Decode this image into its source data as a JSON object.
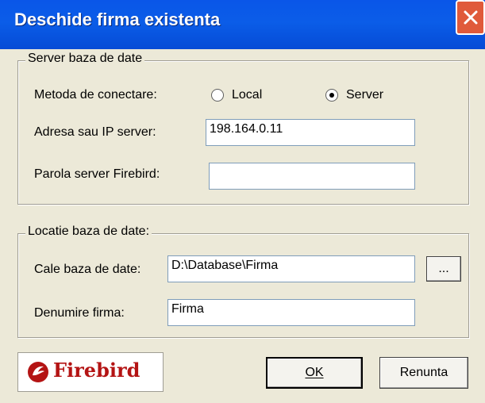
{
  "window": {
    "title": "Deschide firma existenta"
  },
  "server_group": {
    "title": "Server baza de date",
    "method_label": "Metoda de conectare:",
    "option_local": "Local",
    "option_server": "Server",
    "selected_method": "Server",
    "address_label": "Adresa sau IP server:",
    "address_value": "198.164.0.11",
    "password_label": "Parola server Firebird:",
    "password_value": ""
  },
  "location_group": {
    "title": "Locatie baza de date:",
    "path_label": "Cale baza de date:",
    "path_value": "D:\\Database\\Firma",
    "browse_label": "...",
    "name_label": "Denumire firma:",
    "name_value": "Firma"
  },
  "logo": {
    "text": "Firebird"
  },
  "buttons": {
    "ok": "OK",
    "cancel": "Renunta"
  },
  "colors": {
    "titlebar": "#0a56e8",
    "close": "#e05a3a",
    "dialog_bg": "#ece9d8",
    "logo_red": "#b41414"
  }
}
